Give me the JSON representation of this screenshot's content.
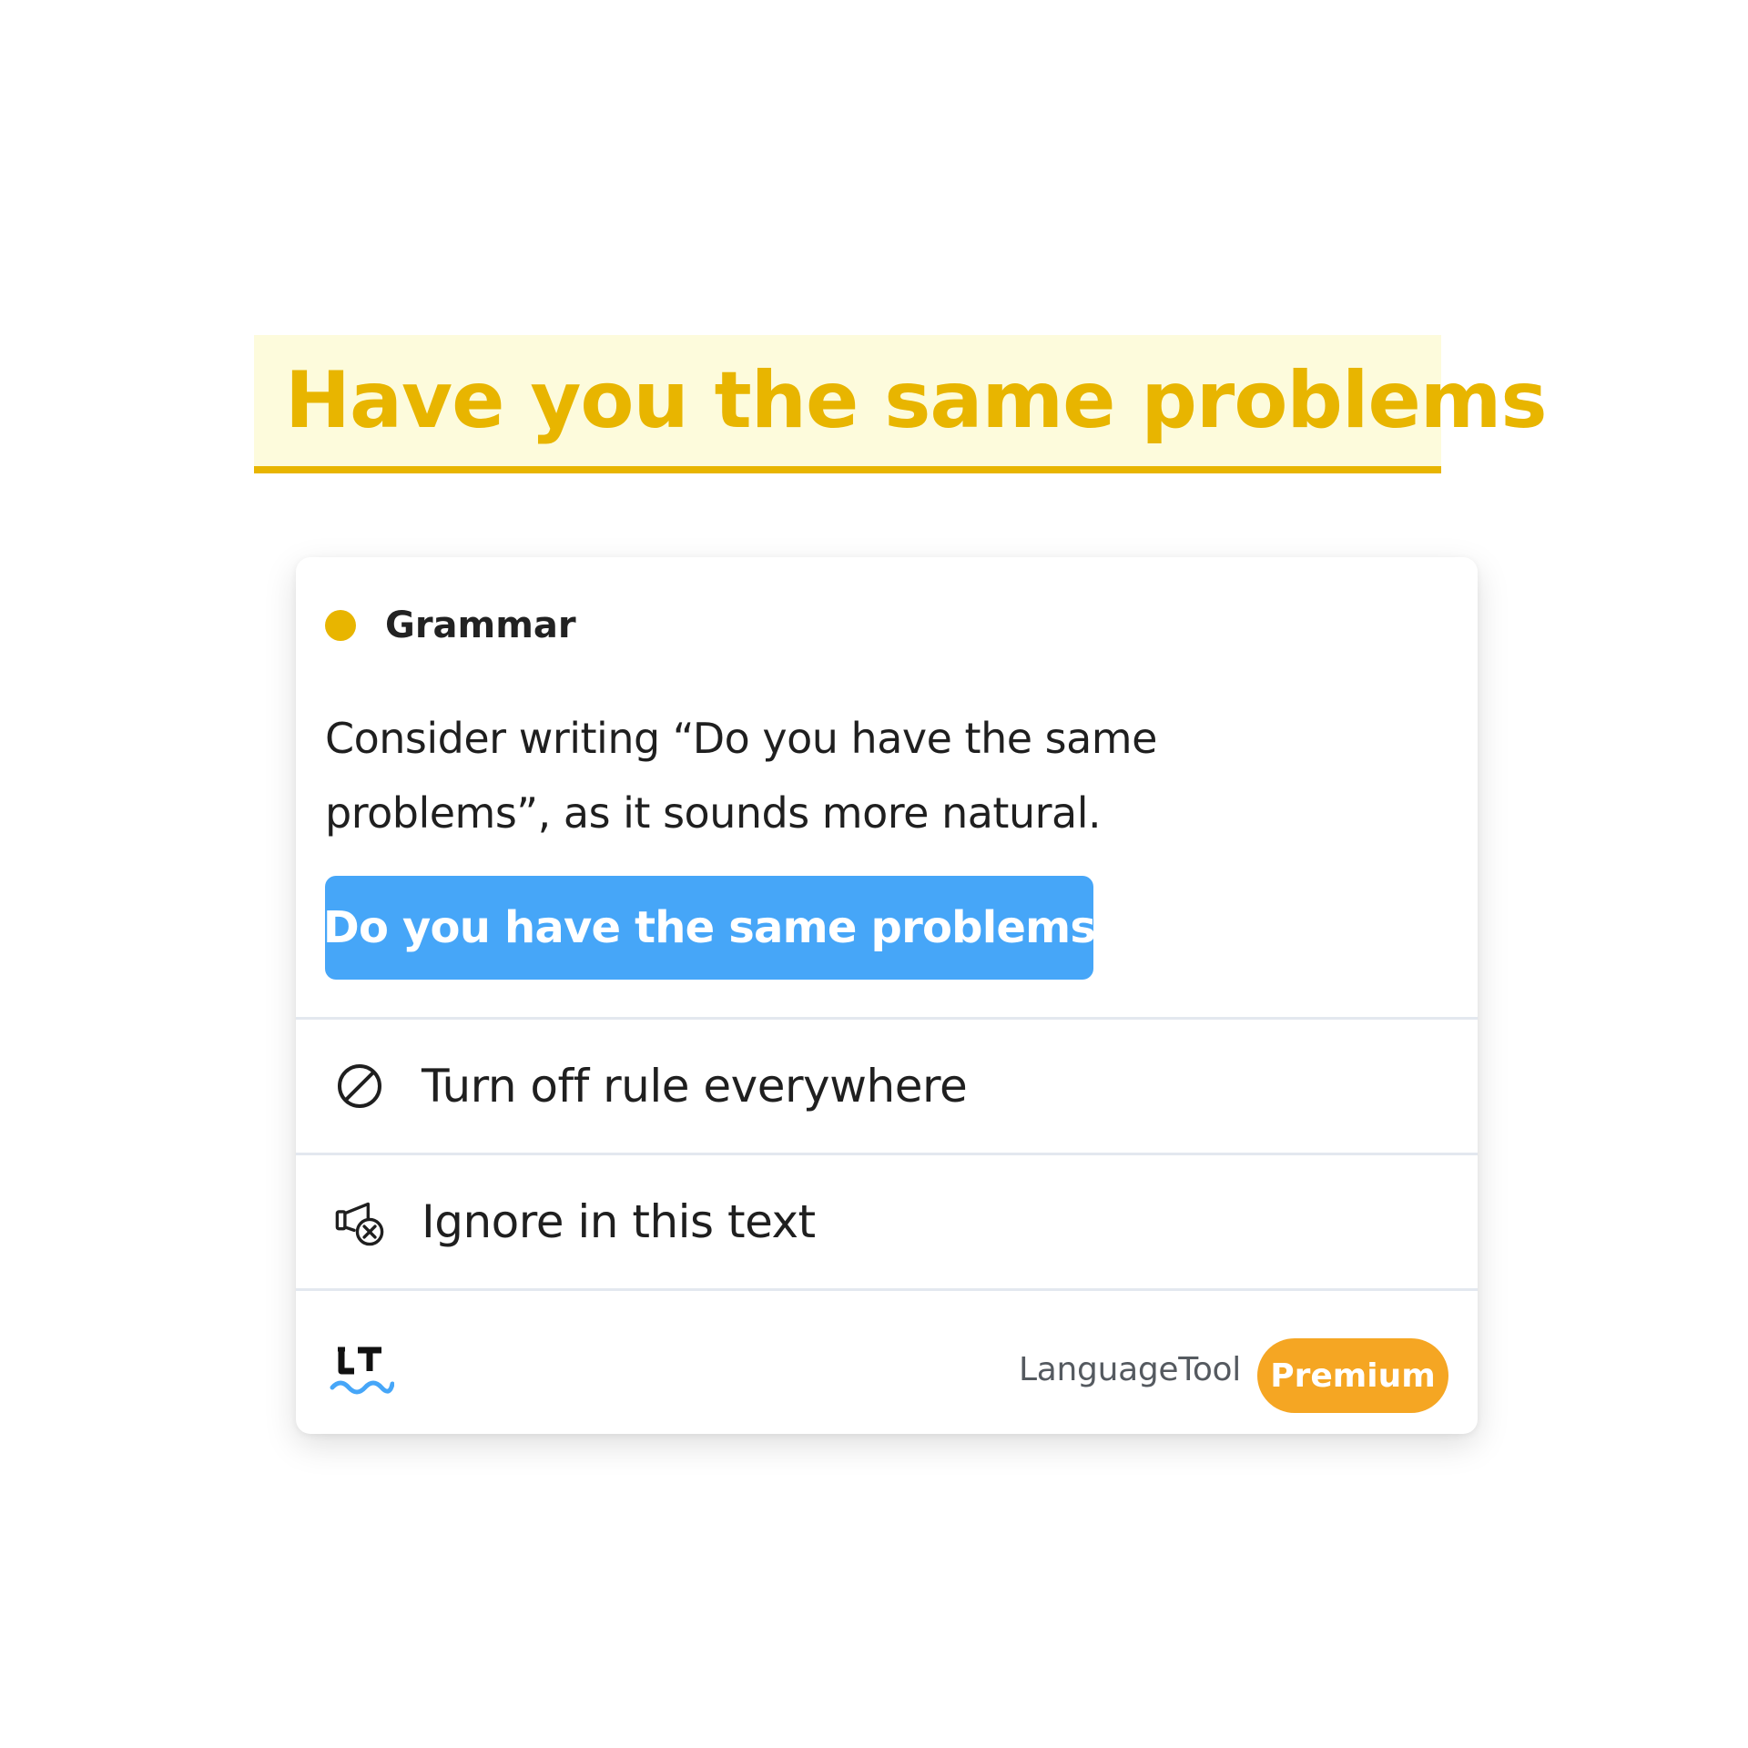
{
  "highlighted_text": "Have you the same problems",
  "card": {
    "category": "Grammar",
    "message": "Consider writing “Do you have the same problems”, as it sounds more natural.",
    "suggestion": "Do you have the same problems",
    "actions": [
      {
        "icon": "forbidden-icon",
        "label": "Turn off rule everywhere"
      },
      {
        "icon": "ignore-speaker-icon",
        "label": "Ignore in this text"
      }
    ],
    "footer": {
      "logo": "LT",
      "brand": "LanguageTool",
      "premium_label": "Premium"
    }
  },
  "colors": {
    "grammar_accent": "#e8b500",
    "suggestion_button": "#46a6f8",
    "premium_badge": "#f5a623",
    "highlight_background": "#fdfbdc"
  }
}
